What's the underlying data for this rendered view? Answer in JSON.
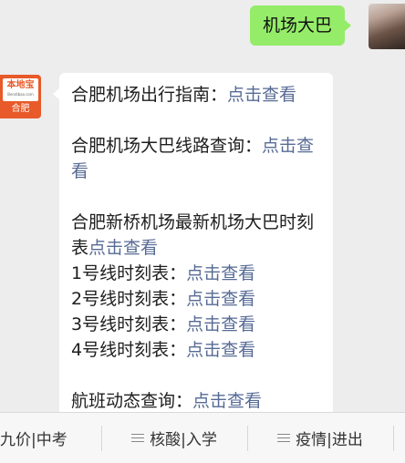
{
  "outgoing": {
    "text": "机场大巴"
  },
  "incoming": {
    "avatar": {
      "brand": "本地宝",
      "site": "Bendibao.com",
      "city": "合肥"
    },
    "lines": [
      {
        "text": "合肥机场出行指南：",
        "link": "点击查看"
      },
      {
        "text": "合肥机场大巴线路查询：",
        "link": "点击查看"
      },
      {
        "text": "合肥新桥机场最新机场大巴时刻表",
        "link": "点击查看"
      },
      {
        "text": "1号线时刻表：",
        "link": "点击查看"
      },
      {
        "text": "2号线时刻表：",
        "link": "点击查看"
      },
      {
        "text": "3号线时刻表：",
        "link": "点击查看"
      },
      {
        "text": "4号线时刻表：",
        "link": "点击查看"
      },
      {
        "text": "航班动态查询：",
        "link": "点击查看"
      }
    ]
  },
  "menu": {
    "items": [
      {
        "label": "九价|中考"
      },
      {
        "label": "核酸|入学"
      },
      {
        "label": "疫情|进出"
      }
    ]
  },
  "colors": {
    "outgoing_bubble": "#95ec69",
    "link": "#576b95",
    "avatar_brand": "#e85a29"
  }
}
